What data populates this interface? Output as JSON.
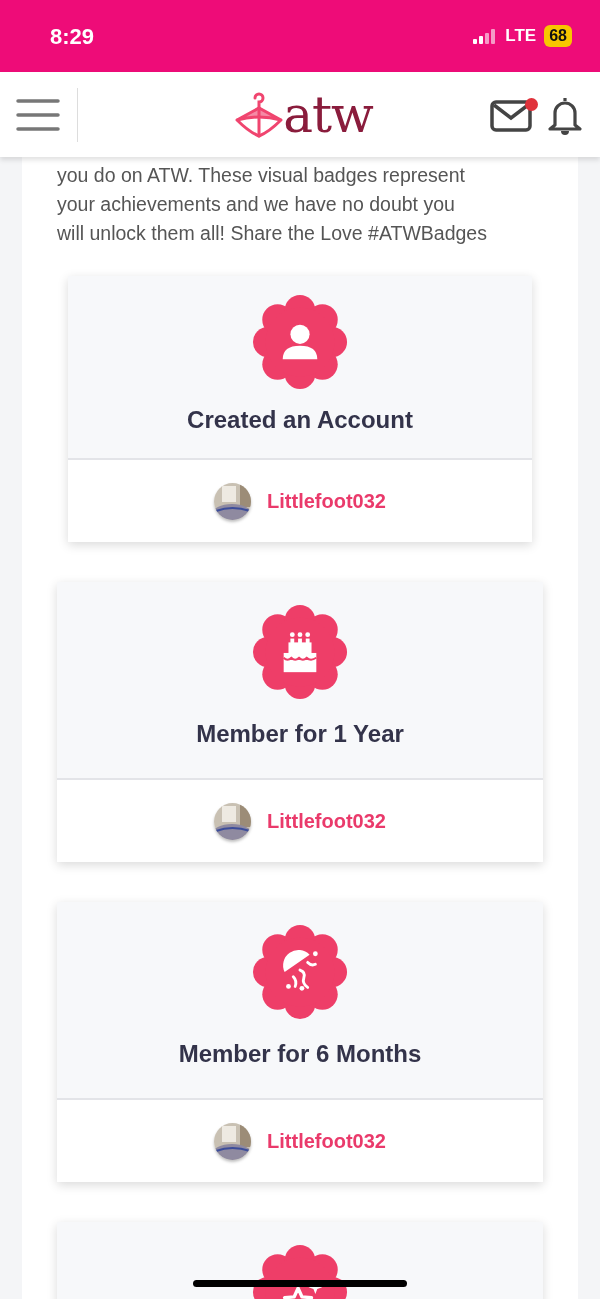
{
  "status_bar": {
    "time": "8:29",
    "network": "LTE",
    "battery": "68"
  },
  "header": {
    "logo_text": "atw",
    "mail_unread": true
  },
  "intro_lines": [
    "you do on ATW. These visual badges represent",
    "your achievements and we have no doubt you",
    "will unlock them all! Share the Love #ATWBadges"
  ],
  "badges": [
    {
      "kind": "person",
      "title": "Created an Account",
      "username": "Littlefoot032"
    },
    {
      "kind": "cake",
      "title": "Member for 1 Year",
      "username": "Littlefoot032"
    },
    {
      "kind": "jellyfish",
      "title": "Member for 6 Months",
      "username": "Littlefoot032"
    },
    {
      "kind": "stars"
    }
  ]
}
